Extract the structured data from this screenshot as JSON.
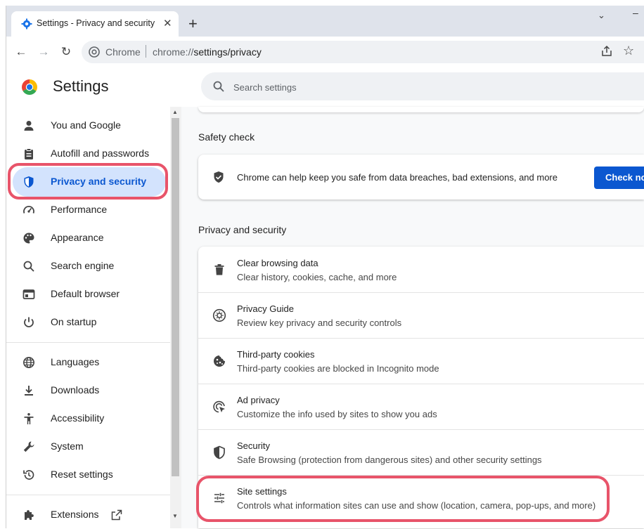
{
  "browser": {
    "tab": {
      "title": "Settings - Privacy and security",
      "close": "✕"
    },
    "new_tab": "+",
    "tab_search": "⌄",
    "window_min": "–",
    "nav": {
      "back": "←",
      "forward": "→",
      "reload": "↻"
    },
    "omnibox": {
      "chip": "Chrome",
      "url_scheme": "chrome://",
      "url_path": "settings/privacy"
    },
    "star": "☆"
  },
  "settings": {
    "title": "Settings",
    "search_placeholder": "Search settings"
  },
  "sidebar": {
    "items": [
      {
        "label": "You and Google",
        "icon": "person-icon"
      },
      {
        "label": "Autofill and passwords",
        "icon": "clipboard-icon"
      },
      {
        "label": "Privacy and security",
        "icon": "shield-icon",
        "active": true
      },
      {
        "label": "Performance",
        "icon": "gauge-icon"
      },
      {
        "label": "Appearance",
        "icon": "palette-icon"
      },
      {
        "label": "Search engine",
        "icon": "search-icon"
      },
      {
        "label": "Default browser",
        "icon": "browser-window-icon"
      },
      {
        "label": "On startup",
        "icon": "power-icon"
      },
      {
        "label": "Languages",
        "icon": "globe-icon"
      },
      {
        "label": "Downloads",
        "icon": "download-icon"
      },
      {
        "label": "Accessibility",
        "icon": "accessibility-icon"
      },
      {
        "label": "System",
        "icon": "wrench-icon"
      },
      {
        "label": "Reset settings",
        "icon": "reset-history-icon"
      },
      {
        "label": "Extensions",
        "icon": "puzzle-icon"
      }
    ]
  },
  "main": {
    "safety_check": {
      "heading": "Safety check",
      "text": "Chrome can help keep you safe from data breaches, bad extensions, and more",
      "button": "Check now"
    },
    "privacy": {
      "heading": "Privacy and security",
      "rows": [
        {
          "title": "Clear browsing data",
          "subtitle": "Clear history, cookies, cache, and more",
          "icon": "trash-icon"
        },
        {
          "title": "Privacy Guide",
          "subtitle": "Review key privacy and security controls",
          "icon": "compass-icon"
        },
        {
          "title": "Third-party cookies",
          "subtitle": "Third-party cookies are blocked in Incognito mode",
          "icon": "cookie-icon"
        },
        {
          "title": "Ad privacy",
          "subtitle": "Customize the info used by sites to show you ads",
          "icon": "ad-target-icon"
        },
        {
          "title": "Security",
          "subtitle": "Safe Browsing (protection from dangerous sites) and other security settings",
          "icon": "shield-half-icon"
        },
        {
          "title": "Site settings",
          "subtitle": "Controls what information sites can use and show (location, camera, pop-ups, and more)",
          "icon": "sliders-icon"
        }
      ]
    }
  },
  "colors": {
    "accent": "#0b57d0",
    "active_bg": "#d3e3fd",
    "highlight": "#e8546a"
  }
}
